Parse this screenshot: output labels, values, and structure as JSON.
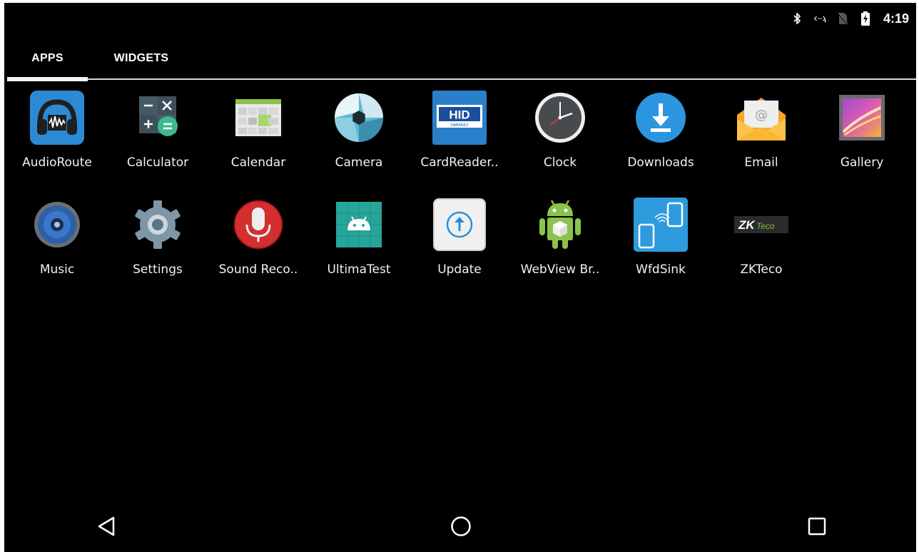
{
  "status_bar": {
    "time": "4:19",
    "icons": [
      "bluetooth-icon",
      "data-sync-icon",
      "no-sim-icon",
      "battery-charging-icon"
    ]
  },
  "tabs": [
    {
      "label": "APPS",
      "selected": true
    },
    {
      "label": "WIDGETS",
      "selected": false
    }
  ],
  "apps": [
    {
      "label": "AudioRoute",
      "icon": "audioroute-icon"
    },
    {
      "label": "Calculator",
      "icon": "calculator-icon"
    },
    {
      "label": "Calendar",
      "icon": "calendar-icon"
    },
    {
      "label": "Camera",
      "icon": "camera-icon"
    },
    {
      "label": "CardReader..",
      "icon": "hid-cardreader-icon"
    },
    {
      "label": "Clock",
      "icon": "clock-icon"
    },
    {
      "label": "Downloads",
      "icon": "downloads-icon"
    },
    {
      "label": "Email",
      "icon": "email-icon"
    },
    {
      "label": "Gallery",
      "icon": "gallery-icon"
    },
    {
      "label": "Music",
      "icon": "music-speaker-icon"
    },
    {
      "label": "Settings",
      "icon": "settings-gear-icon"
    },
    {
      "label": "Sound Reco..",
      "icon": "microphone-icon"
    },
    {
      "label": "UltimaTest",
      "icon": "android-test-icon"
    },
    {
      "label": "Update",
      "icon": "update-arrow-icon"
    },
    {
      "label": "WebView Br..",
      "icon": "android-robot-icon"
    },
    {
      "label": "WfdSink",
      "icon": "wifi-display-icon"
    },
    {
      "label": "ZKTeco",
      "icon": "zkteco-logo-icon"
    }
  ],
  "icon_text": {
    "hid_big": "HID",
    "hid_small": "OMNIKEY",
    "zk_main": "ZK",
    "zk_sub": "Teco"
  },
  "nav_bar": {
    "icons": [
      "back-triangle-icon",
      "home-circle-icon",
      "recents-square-icon"
    ]
  },
  "colors": {
    "background": "#000000",
    "text": "#ffffff",
    "tab_underline": "#d8d8d8",
    "accent_blue": "#2a8fd8"
  }
}
